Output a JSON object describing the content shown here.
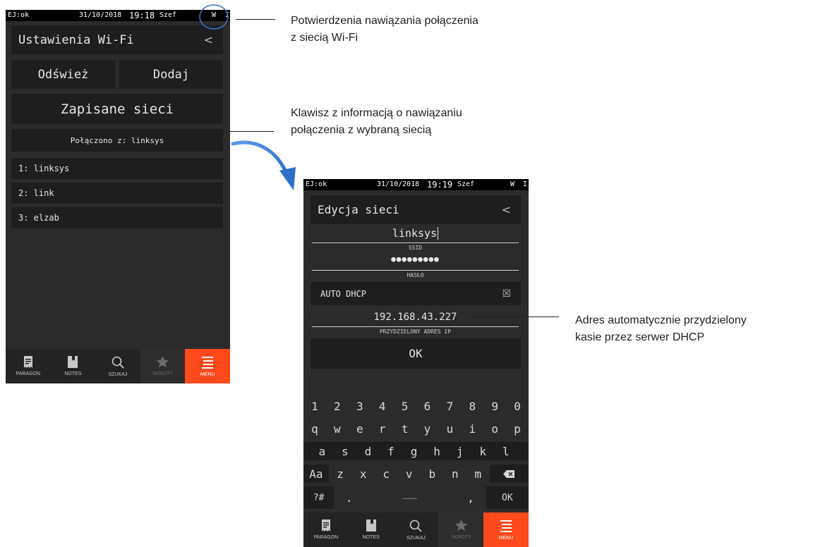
{
  "screen1": {
    "status": {
      "ej": "EJ:ok",
      "date": "31/10/2018",
      "time": "19:18",
      "user": "Szef",
      "wifi": "W",
      "info": "I"
    },
    "header": {
      "title": "Ustawienia Wi-Fi",
      "back": "<"
    },
    "buttons": {
      "refresh": "Odśwież",
      "add": "Dodaj",
      "saved": "Zapisane sieci"
    },
    "connected": "Połączono z: linksys",
    "networks": [
      "1: linksys",
      "2: link",
      "3: elzab"
    ]
  },
  "screen2": {
    "status": {
      "ej": "EJ:ok",
      "date": "31/10/2018",
      "time": "19:19",
      "user": "Szef",
      "wifi": "W",
      "info": "I"
    },
    "header": {
      "title": "Edycja sieci",
      "back": "<"
    },
    "ssid": {
      "value": "linksys",
      "label": "SSID"
    },
    "password": {
      "value": "●●●●●●●●●",
      "label": "HASŁO"
    },
    "dhcp": {
      "label": "AUTO DHCP",
      "checked": true,
      "mark": "☒"
    },
    "ip": {
      "value": "192.168.43.227",
      "label": "PRZYDZIELONY ADRES IP"
    },
    "ok": "OK",
    "keyboard": {
      "row1": [
        "1",
        "2",
        "3",
        "4",
        "5",
        "6",
        "7",
        "8",
        "9",
        "0"
      ],
      "row2": [
        "q",
        "w",
        "e",
        "r",
        "t",
        "y",
        "u",
        "i",
        "o",
        "p"
      ],
      "row3": [
        "a",
        "s",
        "d",
        "f",
        "g",
        "h",
        "j",
        "k",
        "l"
      ],
      "row4": [
        "Aa",
        "z",
        "x",
        "c",
        "v",
        "b",
        "n",
        "m"
      ],
      "row5": {
        "sym": "?#",
        "dot": ".",
        "space": "―――",
        "comma": ",",
        "ok": "OK"
      }
    }
  },
  "nav": {
    "items": [
      {
        "label": "PARAGON",
        "icon": "receipt-icon"
      },
      {
        "label": "NOTES",
        "icon": "notebook-icon"
      },
      {
        "label": "SZUKAJ",
        "icon": "search-icon"
      },
      {
        "label": "SKRÓTY",
        "icon": "star-icon"
      },
      {
        "label": "MENU",
        "icon": "menu-icon"
      }
    ]
  },
  "annotations": {
    "wifi": [
      "Potwierdzenia nawiązania połączenia",
      "z  siecią Wi-Fi"
    ],
    "button": [
      "Klawisz z informacją o nawiązaniu",
      "połączenia z wybraną siecią"
    ],
    "dhcp": [
      "Adres automatycznie przydzielony",
      "kasie przez serwer DHCP"
    ]
  },
  "colors": {
    "accent": "#ff4a1c",
    "screen_bg": "#2b2b2b",
    "tile_bg": "#1e1e1e",
    "arrow": "#3a7fd5",
    "circle": "#3a6fc0"
  }
}
